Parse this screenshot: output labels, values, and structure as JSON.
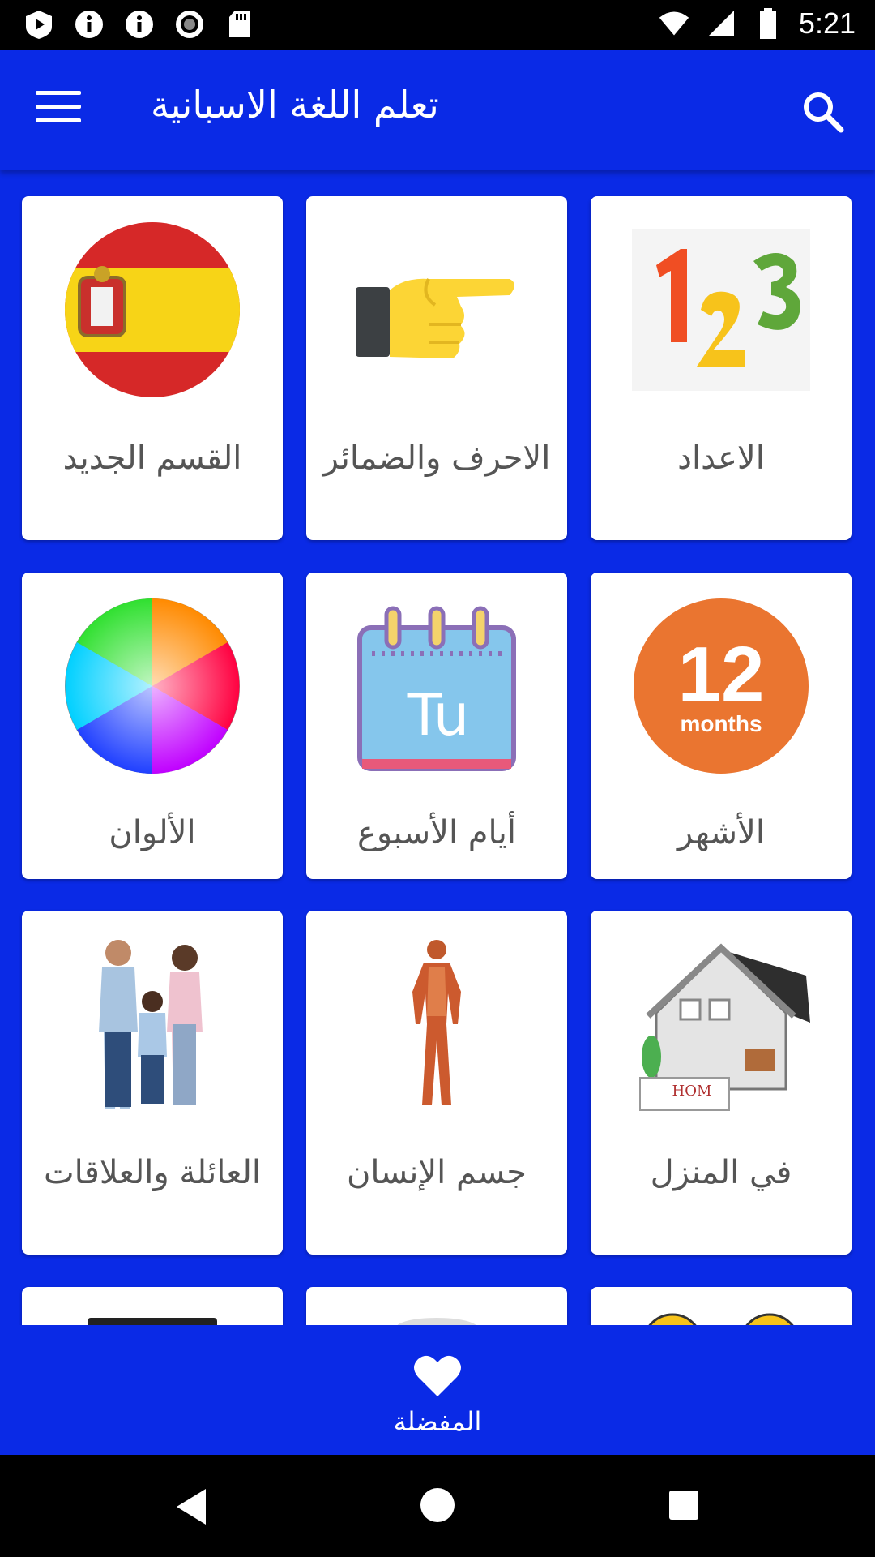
{
  "status_bar": {
    "time": "5:21",
    "left_icons": [
      "notification-play-icon",
      "info-icon",
      "info-icon",
      "record-icon",
      "sd-card-icon"
    ],
    "right_icons": [
      "wifi-icon",
      "signal-icon",
      "battery-icon"
    ]
  },
  "app_bar": {
    "title": "تعلم اللغة الاسبانية"
  },
  "categories": [
    {
      "label": "الاعداد",
      "icon": "numbers-123-icon"
    },
    {
      "label": "الاحرف والضمائر",
      "icon": "pointing-hand-icon"
    },
    {
      "label": "القسم الجديد",
      "icon": "spain-flag-icon"
    },
    {
      "label": "الأشهر",
      "icon": "twelve-months-icon"
    },
    {
      "label": "أيام الأسبوع",
      "icon": "calendar-tu-icon"
    },
    {
      "label": "الألوان",
      "icon": "color-wheel-icon"
    },
    {
      "label": "في المنزل",
      "icon": "house-icon"
    },
    {
      "label": "جسم الإنسان",
      "icon": "human-body-icon"
    },
    {
      "label": "العائلة والعلاقات",
      "icon": "family-icon"
    }
  ],
  "month_badge": {
    "number": "12",
    "word": "months"
  },
  "calendar_badge": {
    "text": "Tu"
  },
  "house_sign": {
    "text": "HOM"
  },
  "bottom_nav": {
    "favorites_label": "المفضلة"
  },
  "colors": {
    "primary": "#0a2ae6",
    "card": "#ffffff",
    "label_text": "#555555"
  }
}
